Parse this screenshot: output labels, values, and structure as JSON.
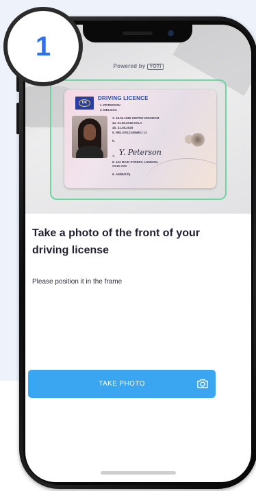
{
  "step": {
    "number": "1"
  },
  "camera": {
    "powered_by": "Powered by",
    "brand": "YOTI"
  },
  "licence": {
    "title": "DRIVING LICENCE",
    "country_code": "UK",
    "lines": [
      "1. PETERSON",
      "2. MELISSA",
      "3. 18.04.1986 UNITED KINGDOM",
      "4a. 01.08.2018   DVLA",
      "4b. 31.08.2028",
      "5. MELIS012345MEIJ 13",
      "6.",
      "7.",
      "8. 123 MAIN STREET, LONDON,",
      "   XX10 XXX",
      "9. AM/B/K/fq"
    ],
    "signature": "Y. Peterson"
  },
  "content": {
    "heading": "Take a photo of the front of your driving license",
    "subtext": "Please position it in the frame"
  },
  "cta": {
    "label": "TAKE PHOTO",
    "icon": "camera-icon"
  },
  "colors": {
    "accent": "#3aa6f2",
    "frame": "#6ed5a2",
    "step_number": "#2f6ff2",
    "background_panel": "#eef3fb"
  }
}
